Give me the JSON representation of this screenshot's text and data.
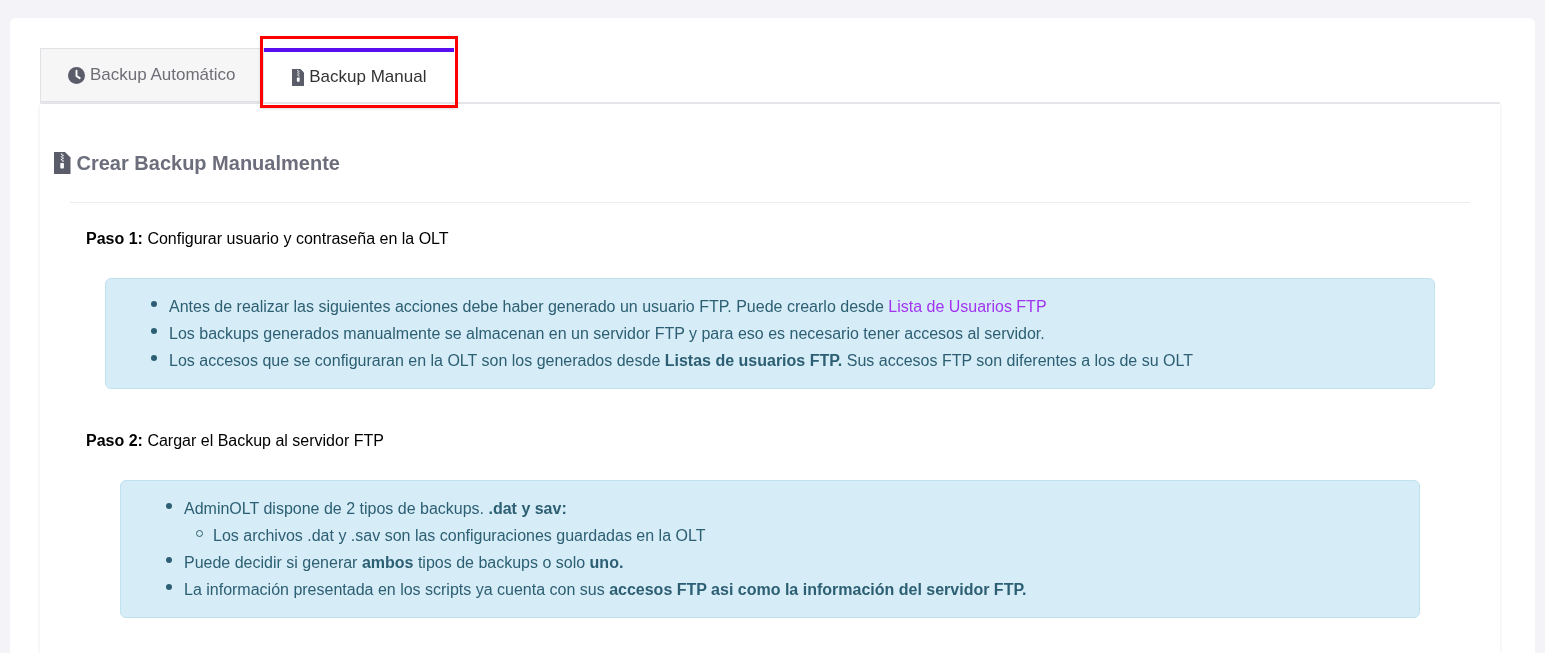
{
  "tabs": [
    {
      "label": "Backup Automático",
      "kind": "automatic",
      "selected": false,
      "annotated": false
    },
    {
      "label": "Backup Manual",
      "kind": "manual",
      "selected": true,
      "annotated": true
    }
  ],
  "heading": "Crear Backup Manualmente",
  "steps": [
    {
      "label": "Paso 1:",
      "text": "Configurar usuario y contraseña en la OLT",
      "items": [
        {
          "text": "Antes de realizar las siguientes acciones debe haber generado un usuario FTP. Puede crearlo desde",
          "link": "Lista de Usuarios FTP"
        },
        {
          "text": "Los backups generados manualmente se almacenan en un servidor FTP y para eso es necesario tener accesos al servidor."
        },
        {
          "text": "Los accesos que se configuraran en la OLT son los generados desde **Listas de usuarios FTP.** Sus accesos FTP son diferentes a los de su OLT"
        }
      ]
    },
    {
      "label": "Paso 2:",
      "text": "Cargar el Backup al servidor FTP",
      "items": [
        {
          "text": "AdminOLT dispone de 2 tipos de backups. **.dat y sav:**",
          "children": [
            {
              "text": "Los archivos .dat y .sav son las configuraciones guardadas en la OLT"
            }
          ]
        },
        {
          "text": "Puede decidir si generar **ambos** tipos de backups o solo **uno.**"
        },
        {
          "text": "La información presentada en los scripts ya cuenta con sus **accesos FTP asi como la información del servidor FTP.**"
        }
      ]
    }
  ]
}
